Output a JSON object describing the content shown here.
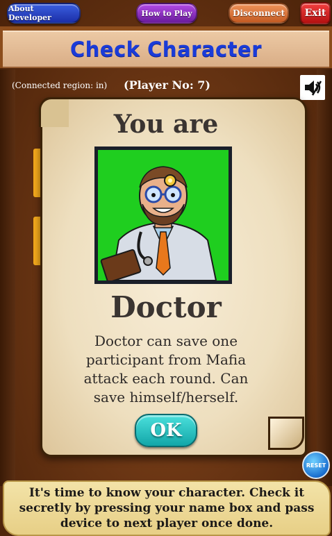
{
  "toolbar": {
    "about_label": "About Developer",
    "how_label": "How to Play",
    "disconnect_label": "Disconnect",
    "exit_label": "Exit"
  },
  "header": {
    "title": "Check Character"
  },
  "info": {
    "region": "(Connected region: in)",
    "player_no": "(Player No: 7)"
  },
  "card": {
    "heading": "You are",
    "role": "Doctor",
    "description": "Doctor can save one participant from Mafia attack each round. Can save himself/herself.",
    "ok_label": "OK"
  },
  "reset_label": "RESET",
  "instruction": "It's time to know your character. Check it secretly by pressing your name box and pass device to next player once done.",
  "icons": {
    "speaker": "speaker-muted-icon",
    "portrait": "doctor-portrait-icon"
  },
  "colors": {
    "title": "#1a3bd8",
    "portrait_bg": "#1fce1f",
    "ok": "#2cc4c4"
  }
}
